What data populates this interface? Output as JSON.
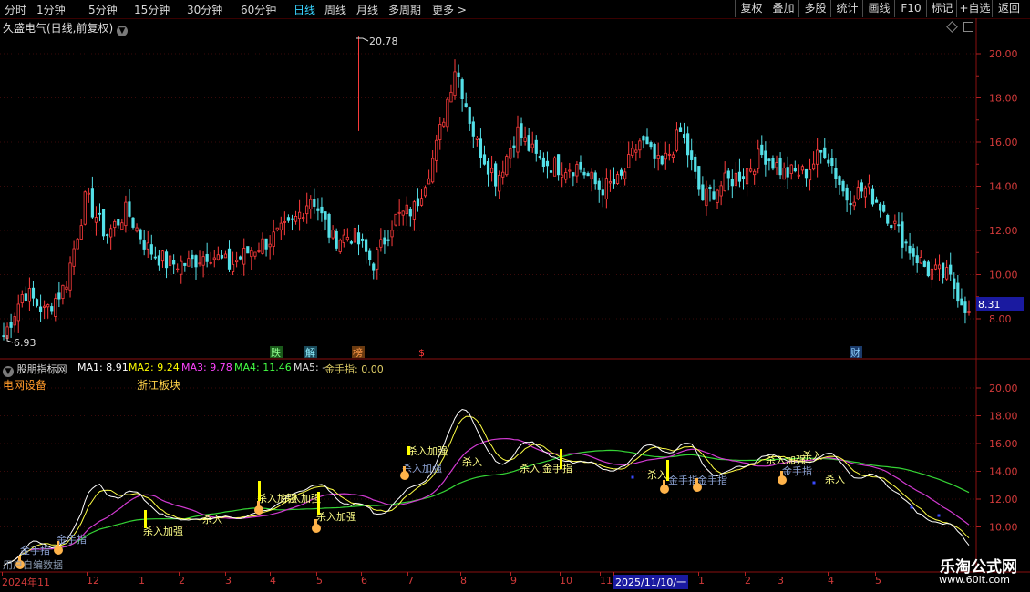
{
  "toolbar": {
    "periods": [
      "分时",
      "1分钟",
      "5分钟",
      "15分钟",
      "30分钟",
      "60分钟",
      "日线",
      "周线",
      "月线",
      "多周期",
      "更多"
    ],
    "active_period": "日线",
    "more_arrow": ">",
    "buttons": [
      "复权",
      "叠加",
      "多股",
      "统计",
      "画线",
      "F10",
      "标记",
      "+自选",
      "返回"
    ]
  },
  "main_chart": {
    "stock_title": "久盛电气(日线,前复权)",
    "price_scale": [
      "20.00",
      "18.00",
      "16.00",
      "14.00",
      "12.00",
      "10.00",
      "8.00"
    ],
    "high_marker": "20.78",
    "low_marker": "6.93",
    "current_price": "8.31",
    "event_tags": [
      "跌",
      "解",
      "榜",
      "$",
      "财"
    ]
  },
  "indicator": {
    "name": "股朋指标网",
    "ma_values": [
      {
        "label": "MA1: 8.91",
        "color": "#ffffff"
      },
      {
        "label": "MA2: 9.24",
        "color": "#ffff00"
      },
      {
        "label": "MA3: 9.78",
        "color": "#ff44ff"
      },
      {
        "label": "MA4: 11.46",
        "color": "#44ff44"
      },
      {
        "label": "MA5: -",
        "color": "#dddddd"
      },
      {
        "label": "金手指: 0.00",
        "color": "#ddcc66"
      }
    ],
    "sector_labels": [
      "电网设备",
      "浙江板块"
    ],
    "price_scale": [
      "20.00",
      "18.00",
      "16.00",
      "14.00",
      "12.00",
      "10.00"
    ],
    "signal_texts": [
      "金手指",
      "金手指",
      "杀入加强",
      "杀入",
      "杀入加强",
      "杀入加强",
      "杀入加强",
      "杀入加强",
      "杀入",
      "杀入",
      "金手指",
      "杀入加强",
      "金手指",
      "金手指",
      "杀入",
      "杀入加强",
      "杀入",
      "杀入",
      "金手指"
    ],
    "footer_text": "用户自编数据"
  },
  "xaxis": {
    "labels": [
      "2024年11",
      "12",
      "1",
      "2",
      "3",
      "4",
      "5",
      "6",
      "7",
      "8",
      "9",
      "10",
      "11",
      "2025/11/10/一",
      "1",
      "2",
      "3",
      "4",
      "5"
    ]
  },
  "watermark": {
    "site": "乐淘公式网",
    "url": "www.60lt.com"
  },
  "chart_data": {
    "type": "candlestick",
    "title": "久盛电气(日线,前复权)",
    "ylim": [
      7.2,
      22.0
    ],
    "high": 20.78,
    "low": 6.93,
    "last": 8.31,
    "close_path": [
      [
        "2024-11",
        7.2
      ],
      [
        "2024-11",
        9.3
      ],
      [
        "2024-11",
        8.3
      ],
      [
        "2024-11",
        9.5
      ],
      [
        "2024-12",
        13.5
      ],
      [
        "2024-12",
        11.8
      ],
      [
        "2024-12",
        12.9
      ],
      [
        "2024-12",
        11.2
      ],
      [
        "2024-12",
        10.5
      ],
      [
        "2025-01",
        10.5
      ],
      [
        "2025-01",
        11.0
      ],
      [
        "2025-02",
        10.4
      ],
      [
        "2025-02",
        11.1
      ],
      [
        "2025-02",
        11.6
      ],
      [
        "2025-03",
        12.2
      ],
      [
        "2025-03",
        13.6
      ],
      [
        "2025-03",
        11.6
      ],
      [
        "2025-04",
        11.8
      ],
      [
        "2025-04",
        10.5
      ],
      [
        "2025-05",
        12.5
      ],
      [
        "2025-05",
        13.0
      ],
      [
        "2025-05",
        15.5
      ],
      [
        "2025-06",
        19.5
      ],
      [
        "2025-06",
        16.0
      ],
      [
        "2025-06",
        14.3
      ],
      [
        "2025-07",
        16.5
      ],
      [
        "2025-07",
        15.2
      ],
      [
        "2025-08",
        14.9
      ],
      [
        "2025-08",
        14.9
      ],
      [
        "2025-09",
        13.9
      ],
      [
        "2025-09",
        14.2
      ],
      [
        "2025-10",
        16.1
      ],
      [
        "2025-10",
        14.8
      ],
      [
        "2025-10",
        16.5
      ],
      [
        "2025-11",
        13.4
      ],
      [
        "2025-11",
        14.1
      ],
      [
        "2025-11",
        14.6
      ],
      [
        "2025-12",
        15.5
      ],
      [
        "2025-12",
        14.6
      ],
      [
        "2026-01",
        14.6
      ],
      [
        "2026-01",
        15.7
      ],
      [
        "2026-01",
        13.5
      ],
      [
        "2026-02",
        13.9
      ],
      [
        "2026-02",
        12.8
      ],
      [
        "2026-03",
        11.3
      ],
      [
        "2026-04",
        10.2
      ],
      [
        "2026-04",
        9.9
      ],
      [
        "2026-05",
        8.31
      ]
    ]
  }
}
